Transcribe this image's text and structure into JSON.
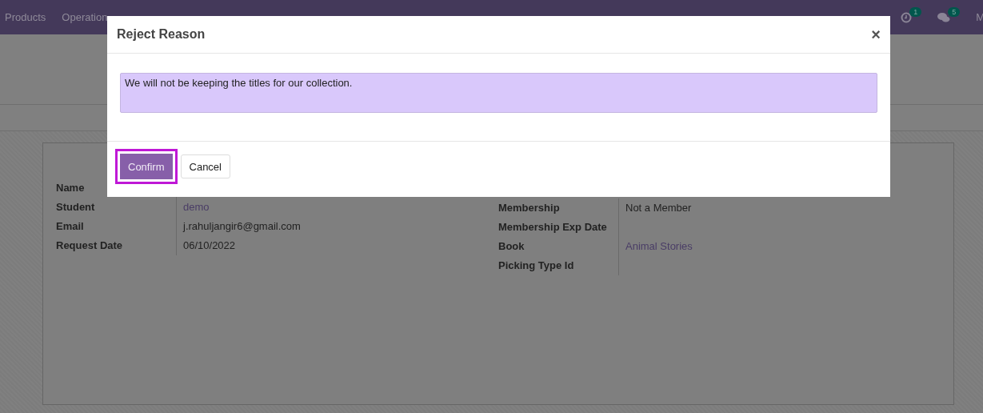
{
  "navbar": {
    "menu": [
      "Products",
      "Operation"
    ],
    "indicators": [
      {
        "kind": "activity",
        "count": "1"
      },
      {
        "kind": "messages",
        "count": "5"
      }
    ],
    "user": "M"
  },
  "form": {
    "left_fields": [
      {
        "label": "Name"
      },
      {
        "label": "Student",
        "value": "demo",
        "kind": "link"
      },
      {
        "label": "Email",
        "value": "j.rahuljangir6@gmail.com",
        "kind": "text"
      },
      {
        "label": "Request Date",
        "value": "06/10/2022",
        "kind": "text"
      }
    ],
    "right_fields": [
      {
        "label": "Membership",
        "value": "Not a Member",
        "kind": "text"
      },
      {
        "label": "Membership Exp Date"
      },
      {
        "label": "Book",
        "value": "Animal Stories",
        "kind": "link"
      },
      {
        "label": "Picking Type Id"
      }
    ]
  },
  "dialog": {
    "title": "Reject Reason",
    "close": "×",
    "reason": "We will not be keeping the titles for our collection.",
    "buttons": [
      {
        "label": "Confirm",
        "kind": "primary",
        "selected": true
      },
      {
        "label": "Cancel",
        "kind": "secondary",
        "selected": false
      }
    ]
  }
}
